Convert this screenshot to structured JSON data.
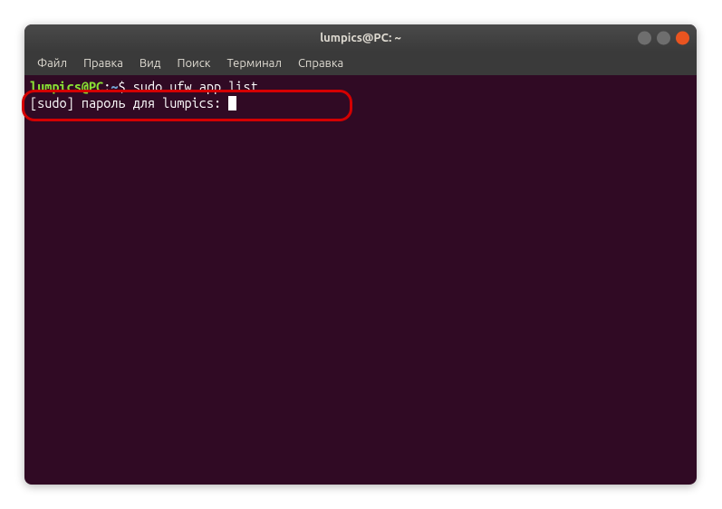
{
  "window": {
    "title": "lumpics@PC: ~"
  },
  "menubar": {
    "items": [
      "Файл",
      "Правка",
      "Вид",
      "Поиск",
      "Терминал",
      "Справка"
    ]
  },
  "terminal": {
    "prompt_user": "lumpics@PC",
    "prompt_sep": ":",
    "prompt_path": "~",
    "prompt_dollar": "$",
    "command": "sudo ufw app list",
    "sudo_prompt": "[sudo] пароль для lumpics: "
  },
  "colors": {
    "bg": "#300a24",
    "user": "#8ae234",
    "path": "#729fcf",
    "text": "#ffffff",
    "close": "#e95420",
    "highlight": "#d40000"
  }
}
